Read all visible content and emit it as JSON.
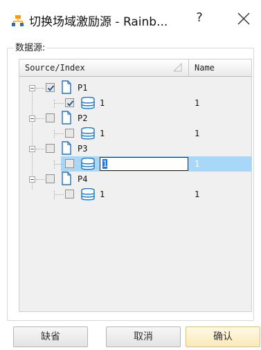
{
  "window": {
    "title": "切换场域激励源 - Rainb...",
    "help_label": "?"
  },
  "group": {
    "label": "数据源:"
  },
  "table": {
    "columns": [
      "Source/Index",
      "Name"
    ],
    "rows": [
      {
        "label": "P1",
        "checked": true,
        "child": {
          "index": "1",
          "name": "1",
          "checked": true
        }
      },
      {
        "label": "P2",
        "checked": false,
        "child": {
          "index": "1",
          "name": "1",
          "checked": false
        }
      },
      {
        "label": "P3",
        "checked": false,
        "child": {
          "index": "1",
          "name": "1",
          "checked": false,
          "selected": true,
          "editing": true
        }
      },
      {
        "label": "P4",
        "checked": false,
        "child": {
          "index": "1",
          "name": "1",
          "checked": false
        }
      }
    ]
  },
  "buttons": {
    "default_label": "缺省",
    "cancel_label": "取消",
    "ok_label": "确认"
  },
  "colors": {
    "selection": "#a8d7f8",
    "icon_blue": "#1e73be",
    "app_icon": "#f39a1e"
  }
}
